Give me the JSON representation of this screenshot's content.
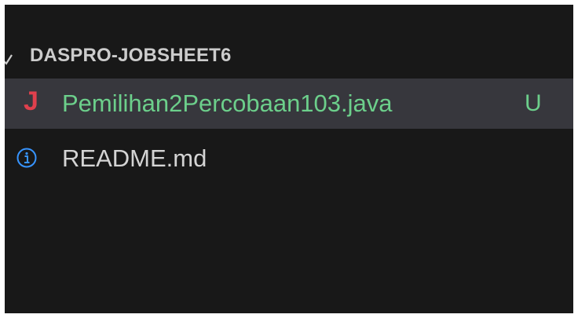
{
  "explorer": {
    "folder": {
      "name": "DASPRO-JOBSHEET6",
      "expanded": true,
      "icon": "chevron-down-icon"
    },
    "files": [
      {
        "name": "Pemilihan2Percobaan103.java",
        "icon": "java-icon",
        "icon_glyph": "J",
        "status": "U",
        "selected": true,
        "color": "#6ccf8b"
      },
      {
        "name": "README.md",
        "icon": "info-icon",
        "status": "",
        "selected": false,
        "color": "#d4d4d4"
      }
    ]
  },
  "colors": {
    "background": "#181818",
    "selection": "#37373d",
    "untracked": "#6ccf8b",
    "java": "#e0404d",
    "info": "#3794ff"
  }
}
